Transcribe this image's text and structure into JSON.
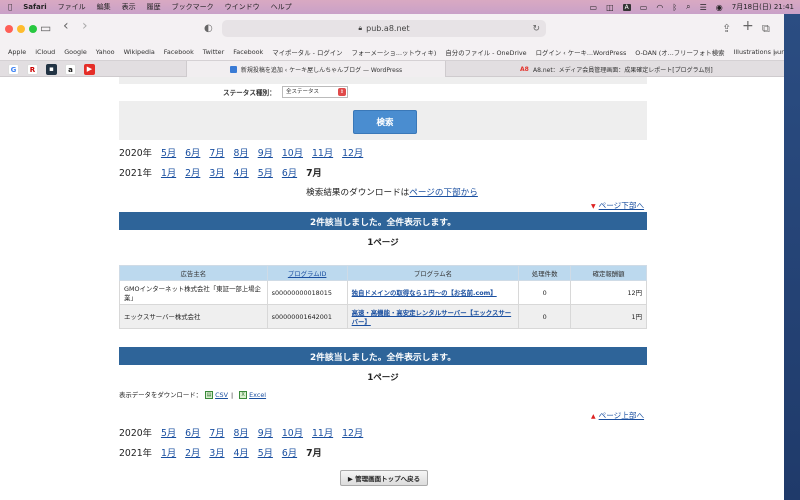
{
  "menubar": {
    "app": "Safari",
    "items": [
      "ファイル",
      "編集",
      "表示",
      "履歴",
      "ブックマーク",
      "ウインドウ",
      "ヘルプ"
    ],
    "input_source": "A",
    "date_time": "7月18日(日)  21:41"
  },
  "browser": {
    "url": "pub.a8.net"
  },
  "bookmarks": [
    "Apple",
    "iCloud",
    "Google",
    "Yahoo",
    "Wikipedia",
    "Facebook",
    "Twitter",
    "Facebook",
    "マイポータル - ログイン",
    "フォーメーショ...ットウィキ)",
    "自分のファイル - OneDrive",
    "ログイン ‹ ケーキ...WordPress",
    "O-DAN (オ...フリーフォト検索",
    "Illustrations | unDraw"
  ],
  "tabs": {
    "tab1": "新規投稿を追加 ‹ ケーキ屋しんちゃんブログ — WordPress",
    "tab2": "A8.net：メディア会員管理画面：成果確定レポート[プログラム別]",
    "tab2_logo": "A8"
  },
  "search": {
    "status_label": "ステータス種別：",
    "status_value": "全ステータス",
    "button": "検索"
  },
  "year_rows_top": [
    {
      "year": "2020年",
      "months": [
        "5月",
        "6月",
        "7月",
        "8月",
        "9月",
        "10月",
        "11月",
        "12月"
      ],
      "current": ""
    },
    {
      "year": "2021年",
      "months": [
        "1月",
        "2月",
        "3月",
        "4月",
        "5月",
        "6月"
      ],
      "current": "7月"
    }
  ],
  "year_rows_bottom": [
    {
      "year": "2020年",
      "months": [
        "5月",
        "6月",
        "7月",
        "8月",
        "9月",
        "10月",
        "11月",
        "12月"
      ],
      "current": ""
    },
    {
      "year": "2021年",
      "months": [
        "1月",
        "2月",
        "3月",
        "4月",
        "5月",
        "6月"
      ],
      "current": "7月"
    }
  ],
  "download_note": {
    "prefix": "検索結果のダウンロードは",
    "link": "ページの下部から"
  },
  "page_bottom_link": "ページ下部へ",
  "page_top_link": "ページ上部へ",
  "result_banner": "2件該当しました。全件表示します。",
  "page_number": "1ページ",
  "table": {
    "headers": [
      "広告主名",
      "プログラムID",
      "プログラム名",
      "処理件数",
      "確定報酬額"
    ],
    "rows": [
      {
        "advertiser": "GMOインターネット株式会社「東証一部上場企業」",
        "program_id": "s00000000018015",
        "program_name": "独自ドメインの取得なら１円〜の【お名前.com】",
        "count": "0",
        "reward": "12円"
      },
      {
        "advertiser": "エックスサーバー株式会社",
        "program_id": "s00000001642001",
        "program_name": "高速・高機能・高安定レンタルサーバー【エックスサーバー】",
        "count": "0",
        "reward": "1円"
      }
    ]
  },
  "download": {
    "label": "表示データをダウンロード：",
    "csv": "CSV",
    "separator": "|",
    "excel": "Excel"
  },
  "back_button": "▶ 管理画面トップへ戻る",
  "colors": {
    "banner": "#2e6499",
    "header_bg": "#bcd9ee",
    "link": "#1a4fa0",
    "search_button": "#4a8dd0"
  }
}
